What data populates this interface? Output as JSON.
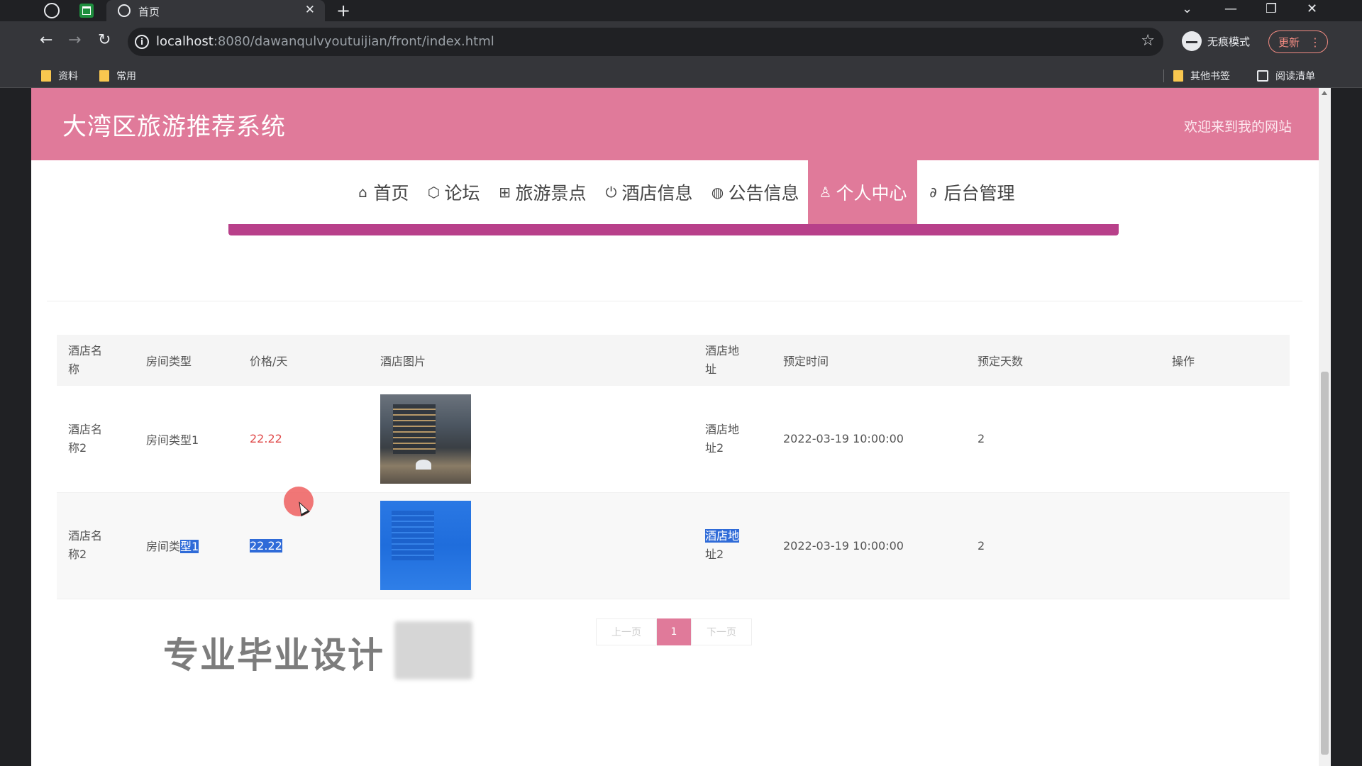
{
  "browser": {
    "tab_title": "首页",
    "url_host": "localhost",
    "url_path": ":8080/dawanqulvyoutuijian/front/index.html",
    "profile_label": "无痕模式",
    "update_label": "更新",
    "bookmarks": [
      {
        "label": "资料"
      },
      {
        "label": "常用"
      }
    ],
    "other_bookmarks_label": "其他书签",
    "reading_list_label": "阅读清单"
  },
  "site": {
    "title": "大湾区旅游推荐系统",
    "welcome": "欢迎来到我的网站"
  },
  "nav": {
    "items": [
      {
        "label": "首页",
        "icon": "home-icon",
        "glyph": "⌂",
        "active": false
      },
      {
        "label": "论坛",
        "icon": "cube-icon",
        "glyph": "⬡",
        "active": false
      },
      {
        "label": "旅游景点",
        "icon": "gift-icon",
        "glyph": "⊞",
        "active": false
      },
      {
        "label": "酒店信息",
        "icon": "power-icon",
        "glyph": "⏻",
        "active": false
      },
      {
        "label": "公告信息",
        "icon": "globe-icon",
        "glyph": "◍",
        "active": false
      },
      {
        "label": "个人中心",
        "icon": "user-icon",
        "glyph": "♙",
        "active": true
      },
      {
        "label": "后台管理",
        "icon": "link-icon",
        "glyph": "∂",
        "active": false
      }
    ]
  },
  "table": {
    "headers": {
      "name": "酒店名称",
      "type": "房间类型",
      "price": "价格/天",
      "image": "酒店图片",
      "address": "酒店地址",
      "time": "预定时间",
      "days": "预定天数",
      "action": "操作"
    },
    "rows": [
      {
        "name": "酒店名称2",
        "type": "房间类型1",
        "price": "22.22",
        "address": "酒店地址2",
        "time": "2022-03-19 10:00:00",
        "days": "2"
      },
      {
        "name": "酒店名称2",
        "type_plain": "房间类",
        "type_selected": "型1",
        "price": "22.22",
        "address_selected": "酒店地",
        "address_plain": "址2",
        "time": "2022-03-19 10:00:00",
        "days": "2"
      }
    ]
  },
  "pagination": {
    "prev": "上一页",
    "current": "1",
    "next": "下一页"
  },
  "watermark": "专业毕业设计",
  "colors": {
    "brand_pink": "#e07a9a",
    "bar_magenta": "#b8408a",
    "price_red": "#e04a4a",
    "selection_blue": "#2f6bd8"
  }
}
